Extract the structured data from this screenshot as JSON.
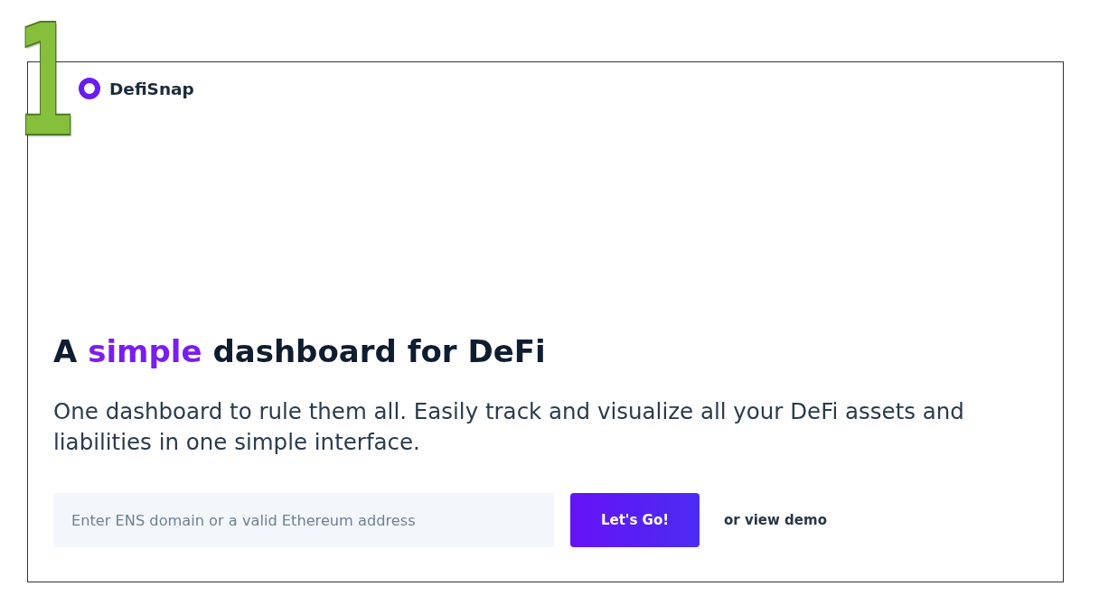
{
  "annotation": {
    "label": "1"
  },
  "brand": {
    "name": "DefiSnap"
  },
  "hero": {
    "heading": [
      {
        "text": "A",
        "highlight": false
      },
      {
        "text": "simple",
        "highlight": true
      },
      {
        "text": "dashboard for DeFi",
        "highlight": false
      }
    ],
    "description": "One dashboard to rule them all. Easily track and visualize all your DeFi assets and liabilities in one simple interface."
  },
  "address_form": {
    "placeholder": "Enter ENS domain or a valid Ethereum address",
    "submit": "Let's Go!",
    "demo_link": "or view demo"
  }
}
